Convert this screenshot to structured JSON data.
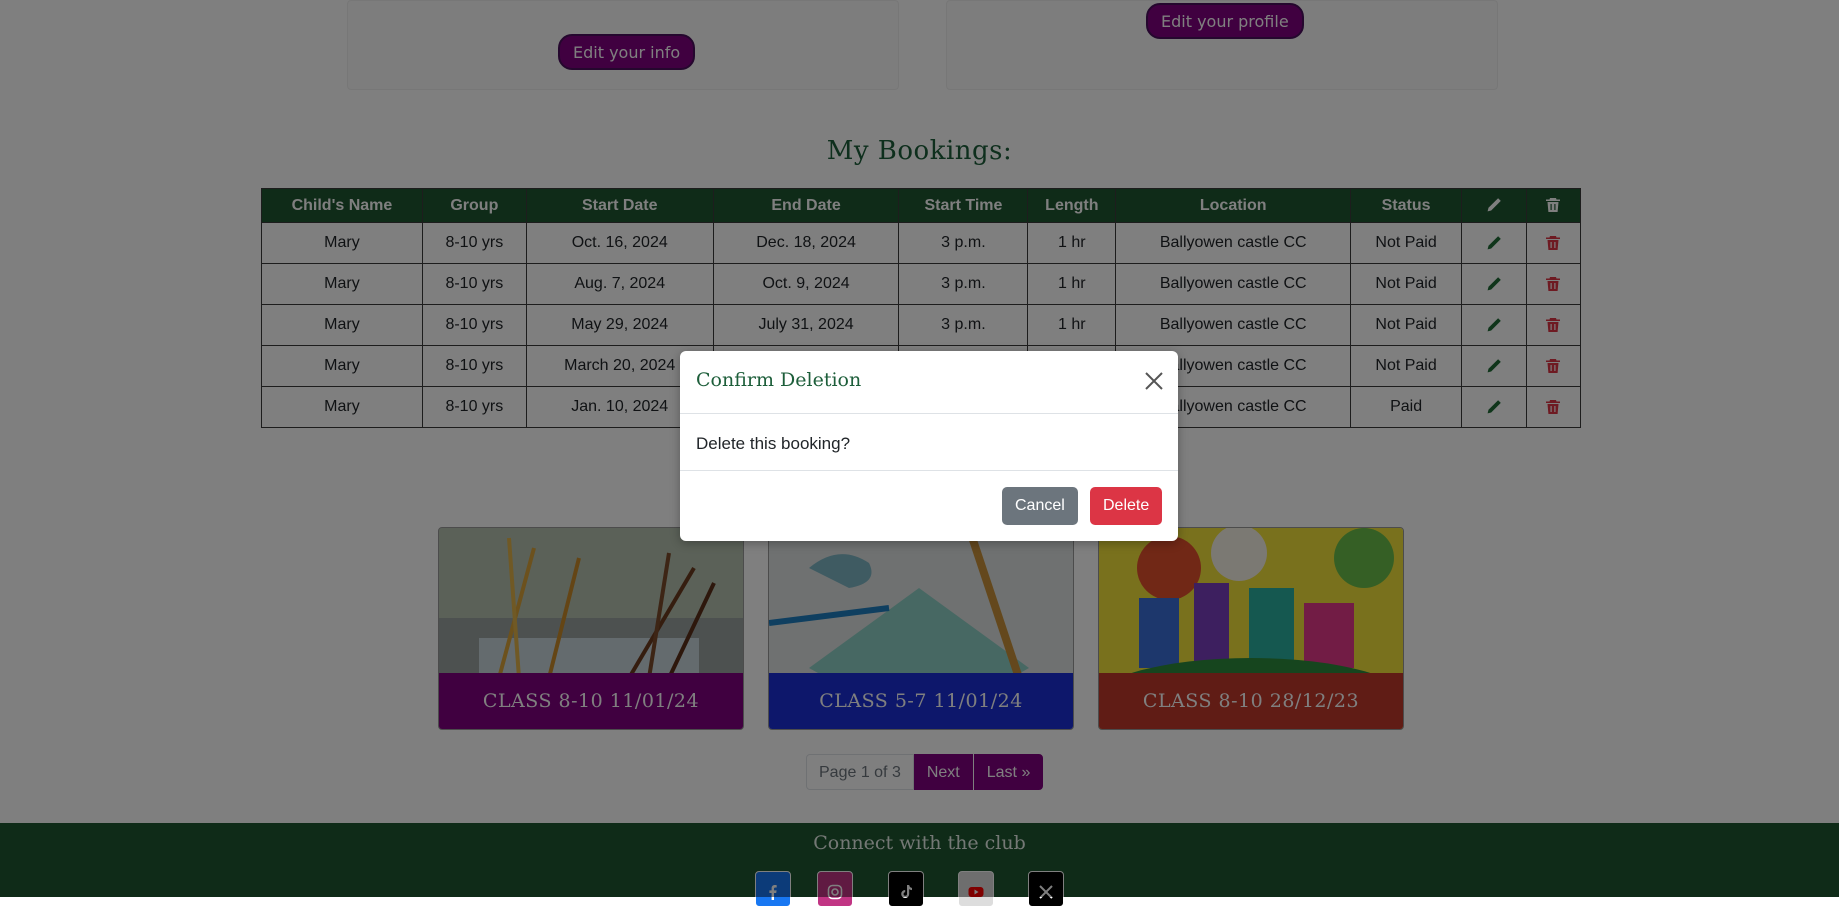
{
  "profile": {
    "edit_info_label": "Edit your info",
    "edit_profile_label": "Edit your profile"
  },
  "bookings": {
    "title": "My Bookings:",
    "columns": [
      "Child's Name",
      "Group",
      "Start Date",
      "End Date",
      "Start Time",
      "Length",
      "Location",
      "Status"
    ],
    "edit_column_icon": "pencil-icon",
    "delete_column_icon": "trash-icon",
    "rows": [
      {
        "child": "Mary",
        "group": "8-10 yrs",
        "start_date": "Oct. 16, 2024",
        "end_date": "Dec. 18, 2024",
        "start_time": "3 p.m.",
        "length": "1 hr",
        "location": "Ballyowen castle CC",
        "status": "Not Paid"
      },
      {
        "child": "Mary",
        "group": "8-10 yrs",
        "start_date": "Aug. 7, 2024",
        "end_date": "Oct. 9, 2024",
        "start_time": "3 p.m.",
        "length": "1 hr",
        "location": "Ballyowen castle CC",
        "status": "Not Paid"
      },
      {
        "child": "Mary",
        "group": "8-10 yrs",
        "start_date": "May 29, 2024",
        "end_date": "July 31, 2024",
        "start_time": "3 p.m.",
        "length": "1 hr",
        "location": "Ballyowen castle CC",
        "status": "Not Paid"
      },
      {
        "child": "Mary",
        "group": "8-10 yrs",
        "start_date": "March 20, 2024",
        "end_date": "",
        "start_time": "",
        "length": "",
        "location": "Ballyowen castle CC",
        "status": "Not Paid"
      },
      {
        "child": "Mary",
        "group": "8-10 yrs",
        "start_date": "Jan. 10, 2024",
        "end_date": "",
        "start_time": "",
        "length": "",
        "location": "Ballyowen castle CC",
        "status": "Paid"
      }
    ]
  },
  "classes": [
    {
      "caption": "CLASS 8-10 11/01/24",
      "color": "#800080"
    },
    {
      "caption": "CLASS 5-7 11/01/24",
      "color": "#1a2fd6"
    },
    {
      "caption": "CLASS 8-10 28/12/23",
      "color": "#c0392b"
    }
  ],
  "pagination": {
    "current": "Page 1 of 3",
    "next": "Next",
    "last": "Last »"
  },
  "footer": {
    "title": "Connect with the club",
    "socials": [
      "facebook-icon",
      "instagram-icon",
      "tiktok-icon",
      "youtube-icon",
      "x-icon"
    ]
  },
  "modal": {
    "title": "Confirm Deletion",
    "body": "Delete this booking?",
    "cancel_label": "Cancel",
    "delete_label": "Delete",
    "close_icon": "close-icon"
  },
  "colors": {
    "brand_green": "#1e5631",
    "brand_purple": "#800080",
    "danger": "#dc3545",
    "secondary": "#6c757d"
  }
}
